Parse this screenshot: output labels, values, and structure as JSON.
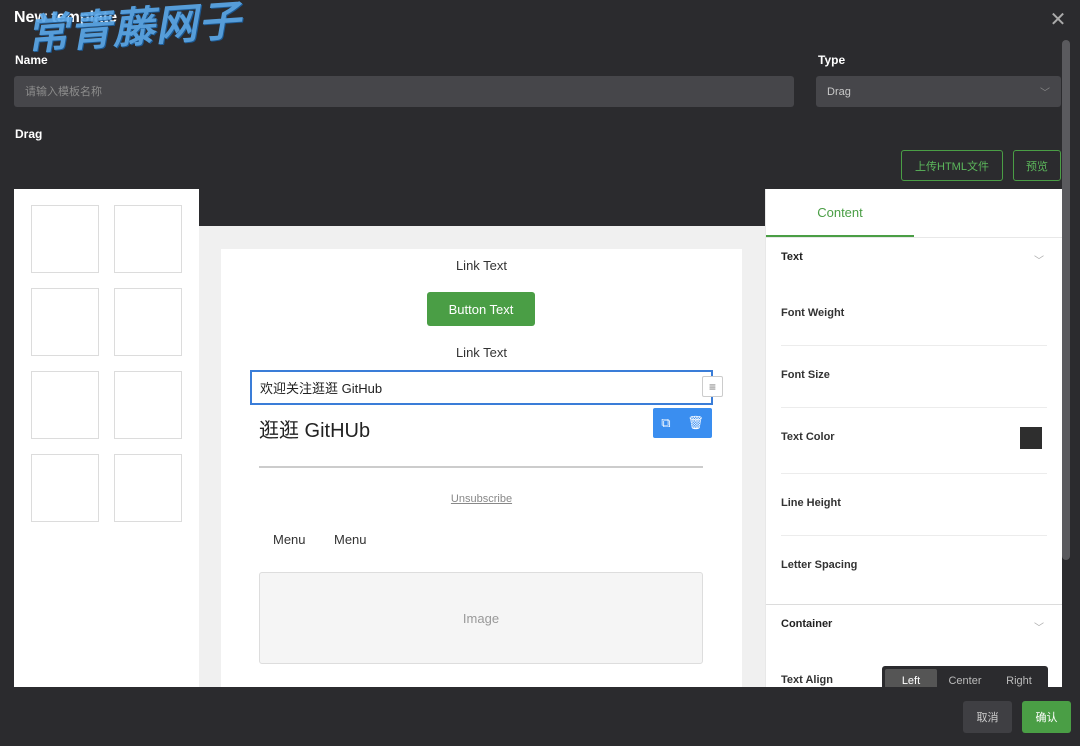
{
  "header": {
    "title": "New template",
    "watermark": "常青藤网子",
    "close_icon": "close-icon"
  },
  "form": {
    "name_label": "Name",
    "name_placeholder": "请输入模板名称",
    "type_label": "Type",
    "type_value": "Drag",
    "drag_label": "Drag"
  },
  "toolbar": {
    "upload_label": "上传HTML文件",
    "preview_label": "预览"
  },
  "canvas": {
    "link_text_1": "Link Text",
    "button_text": "Button Text",
    "link_text_2": "Link Text",
    "selected_text": "欢迎关注逛逛 GitHub",
    "heading": "逛逛 GitHUb",
    "unsubscribe": "Unsubscribe",
    "menu_1": "Menu",
    "menu_2": "Menu",
    "image_label": "Image"
  },
  "props": {
    "tab_content": "Content",
    "section_text": "Text",
    "font_weight": "Font Weight",
    "font_size": "Font Size",
    "text_color": "Text Color",
    "text_color_value": "#2e2e2e",
    "line_height": "Line Height",
    "letter_spacing": "Letter Spacing",
    "section_container": "Container",
    "text_align": "Text Align",
    "align_left": "Left",
    "align_center": "Center",
    "align_right": "Right"
  },
  "footer": {
    "cancel_label": "取消",
    "ok_label": "确认"
  },
  "colors": {
    "accent": "#4a9e45",
    "selection": "#3a7dd8",
    "background": "#2b2b2e"
  }
}
